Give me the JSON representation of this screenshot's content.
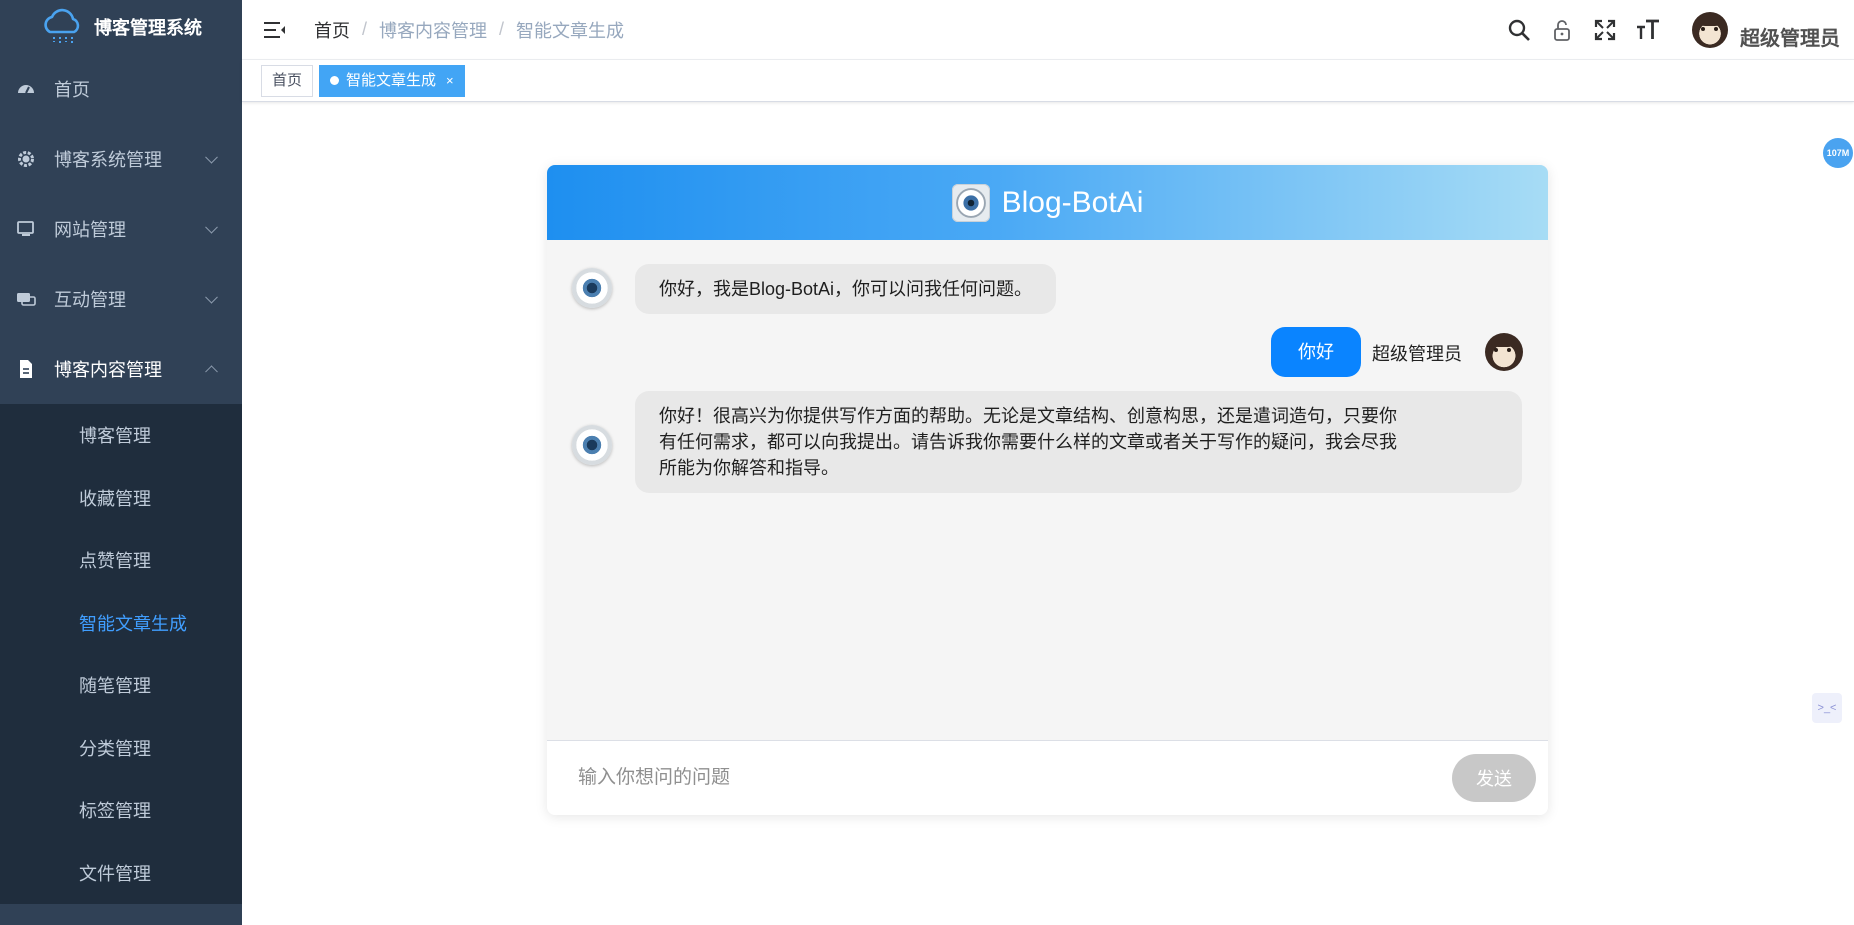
{
  "app": {
    "title": "博客管理系统"
  },
  "sidebar": {
    "menu": [
      {
        "label": "首页",
        "icon": "dashboard-icon"
      },
      {
        "label": "博客系统管理",
        "icon": "gear-icon"
      },
      {
        "label": "网站管理",
        "icon": "monitor-icon"
      },
      {
        "label": "互动管理",
        "icon": "chat-icon"
      },
      {
        "label": "博客内容管理",
        "icon": "document-icon"
      }
    ],
    "submenu": [
      {
        "label": "博客管理"
      },
      {
        "label": "收藏管理"
      },
      {
        "label": "点赞管理"
      },
      {
        "label": "智能文章生成",
        "active": true
      },
      {
        "label": "随笔管理"
      },
      {
        "label": "分类管理"
      },
      {
        "label": "标签管理"
      },
      {
        "label": "文件管理"
      }
    ]
  },
  "breadcrumb": [
    "首页",
    "博客内容管理",
    "智能文章生成"
  ],
  "breadcrumb_sep": "/",
  "header": {
    "user_name": "超级管理员"
  },
  "tags": [
    {
      "label": "首页",
      "active": false
    },
    {
      "label": "智能文章生成",
      "active": true,
      "close": "×"
    }
  ],
  "chat": {
    "title": "Blog-BotAi",
    "messages": [
      {
        "role": "bot",
        "text": "你好，我是Blog-BotAi，你可以问我任何问题。"
      },
      {
        "role": "user",
        "name": "超级管理员",
        "text": "你好"
      },
      {
        "role": "bot",
        "lines": [
          "你好！很高兴为你提供写作方面的帮助。无论是文章结构、创意构思，还是遣词造句，只要你",
          "有任何需求，都可以向我提出。请告诉我你需要什么样的文章或者关于写作的疑问，我会尽我",
          "所能为你解答和指导。"
        ]
      }
    ],
    "input_placeholder": "输入你想问的问题",
    "send_label": "发送"
  },
  "widgets": {
    "memory_badge": "107M",
    "side_icon_text": ">_<"
  },
  "colors": {
    "sidebar_bg": "#304156",
    "submenu_bg": "#1f2d3d",
    "active_text": "#409eff",
    "user_bubble": "#0a84ff",
    "bot_bubble": "#e8e8e8",
    "header_gradient_start": "#1e8ff0",
    "header_gradient_end": "#a7dcf5"
  }
}
